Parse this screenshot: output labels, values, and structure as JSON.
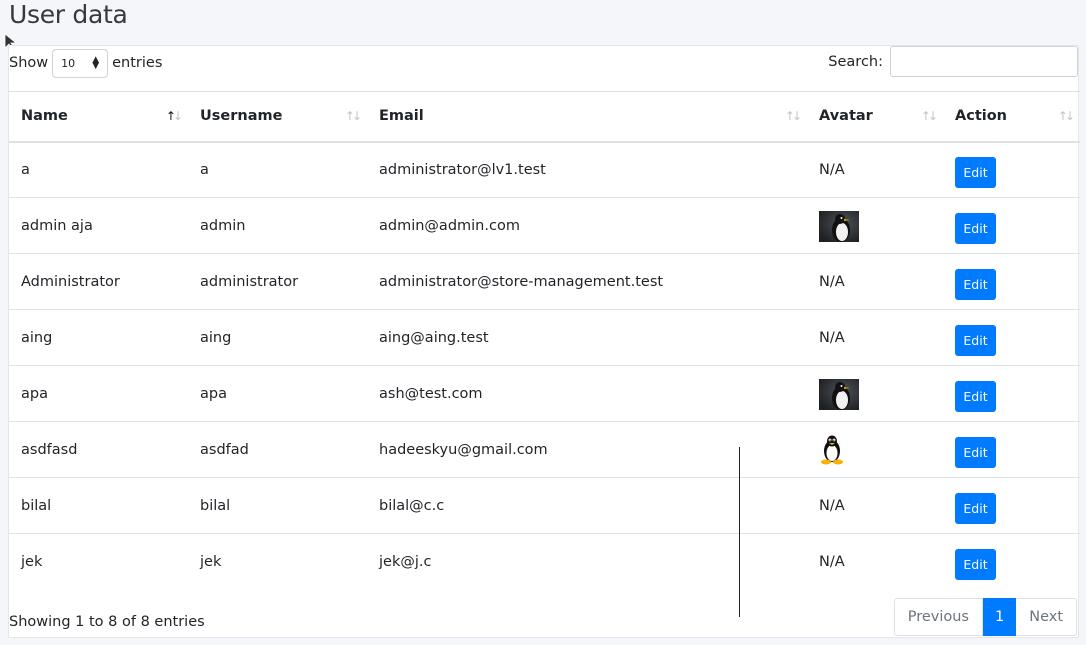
{
  "page": {
    "title": "User data"
  },
  "controls": {
    "show_label": "Show",
    "entries_value": "10",
    "entries_label": "entries",
    "search_label": "Search:",
    "search_value": ""
  },
  "table": {
    "headers": [
      "Name",
      "Username",
      "Email",
      "Avatar",
      "Action"
    ],
    "rows": [
      {
        "name": "a",
        "username": "a",
        "email": "administrator@lv1.test",
        "avatar": "N/A",
        "avatar_type": "text",
        "action": "Edit"
      },
      {
        "name": "admin aja",
        "username": "admin",
        "email": "admin@admin.com",
        "avatar": "penguin-photo",
        "avatar_type": "image",
        "action": "Edit"
      },
      {
        "name": "Administrator",
        "username": "administrator",
        "email": "administrator@store-management.test",
        "avatar": "N/A",
        "avatar_type": "text",
        "action": "Edit"
      },
      {
        "name": "aing",
        "username": "aing",
        "email": "aing@aing.test",
        "avatar": "N/A",
        "avatar_type": "text",
        "action": "Edit"
      },
      {
        "name": "apa",
        "username": "apa",
        "email": "ash@test.com",
        "avatar": "penguin-photo",
        "avatar_type": "image",
        "action": "Edit"
      },
      {
        "name": "asdfasd",
        "username": "asdfad",
        "email": "hadeeskyu@gmail.com",
        "avatar": "tux-icon",
        "avatar_type": "tux",
        "action": "Edit"
      },
      {
        "name": "bilal",
        "username": "bilal",
        "email": "bilal@c.c",
        "avatar": "N/A",
        "avatar_type": "text",
        "action": "Edit"
      },
      {
        "name": "jek",
        "username": "jek",
        "email": "jek@j.c",
        "avatar": "N/A",
        "avatar_type": "text",
        "action": "Edit"
      }
    ]
  },
  "footer": {
    "info": "Showing 1 to 8 of 8 entries",
    "previous": "Previous",
    "current_page": "1",
    "next": "Next"
  },
  "colors": {
    "primary": "#007bff",
    "border": "#dee2e6",
    "background": "#f4f6f9"
  }
}
